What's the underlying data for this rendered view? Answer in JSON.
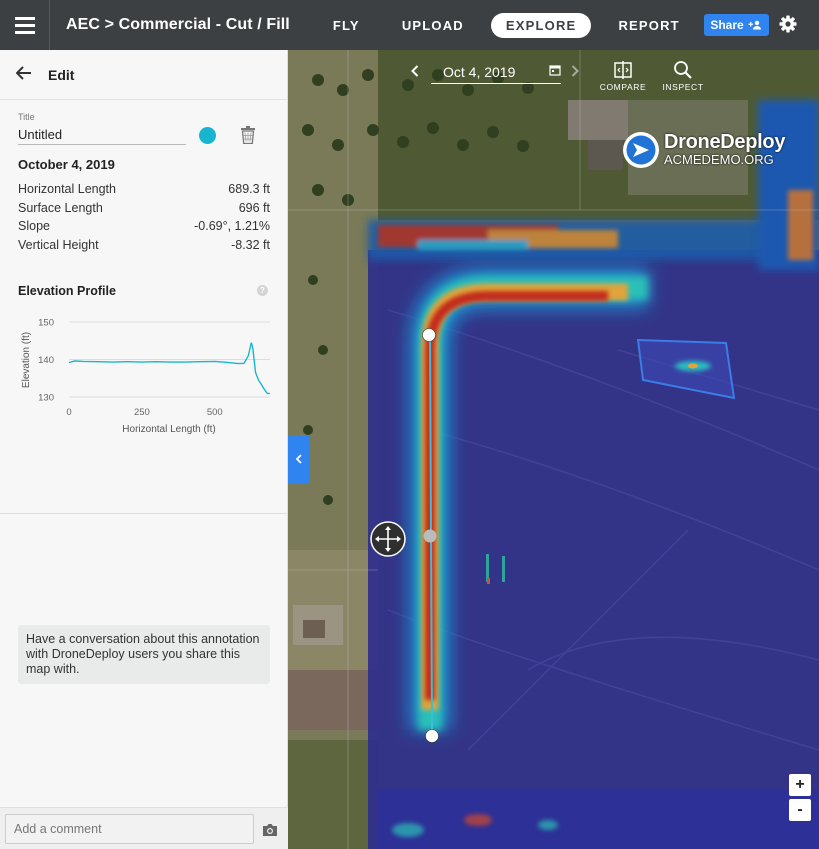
{
  "header": {
    "breadcrumb": "AEC > Commercial - Cut / Fill",
    "nav": [
      {
        "label": "FLY"
      },
      {
        "label": "UPLOAD"
      },
      {
        "label": "EXPLORE"
      },
      {
        "label": "REPORT"
      }
    ],
    "active_tab": "EXPLORE",
    "share_label": "Share"
  },
  "panel": {
    "heading": "Edit",
    "title_label": "Title",
    "title_value": "Untitled",
    "annotation_color": "#16b6d0",
    "date": "October 4, 2019",
    "stats": [
      {
        "label": "Horizontal Length",
        "value": "689.3 ft"
      },
      {
        "label": "Surface Length",
        "value": "696 ft"
      },
      {
        "label": "Slope",
        "value": "-0.69°, 1.21%"
      },
      {
        "label": "Vertical Height",
        "value": "-8.32 ft"
      }
    ],
    "profile_title": "Elevation Profile",
    "help_glyph": "?",
    "conversation_text": "Have a conversation about this annotation with DroneDeploy users you share this map with.",
    "comment_placeholder": "Add a comment"
  },
  "chart_data": {
    "type": "line",
    "xlabel": "Horizontal Length (ft)",
    "ylabel": "Elevation (ft)",
    "xticks": [
      "0",
      "250",
      "500"
    ],
    "yticks": [
      "150",
      "140",
      "130"
    ],
    "xlim": [
      0,
      689.3
    ],
    "ylim": [
      130,
      150
    ],
    "line_color": "#16b6d0",
    "series": [
      {
        "x": [
          0,
          20,
          50,
          100,
          150,
          200,
          250,
          300,
          350,
          400,
          450,
          500,
          530,
          560,
          580,
          600,
          615,
          625,
          630,
          640,
          650,
          660,
          670,
          680,
          689
        ],
        "y": [
          139.2,
          139.6,
          139.5,
          139.4,
          139.3,
          139.4,
          139.3,
          139.4,
          139.3,
          139.3,
          139.4,
          139.5,
          139.3,
          139.1,
          138.9,
          139.0,
          141.0,
          144.5,
          143.2,
          136.5,
          134.5,
          133.3,
          132.0,
          131.0,
          130.9
        ]
      }
    ]
  },
  "map": {
    "date_label": "Oct 4, 2019",
    "tools": [
      {
        "label": "COMPARE",
        "icon": "compare-icon"
      },
      {
        "label": "INSPECT",
        "icon": "inspect-icon"
      }
    ],
    "brand_name": "DroneDeploy",
    "brand_sub": "ACMEDEMO.ORG",
    "zoom_in": "+",
    "zoom_out": "-"
  }
}
